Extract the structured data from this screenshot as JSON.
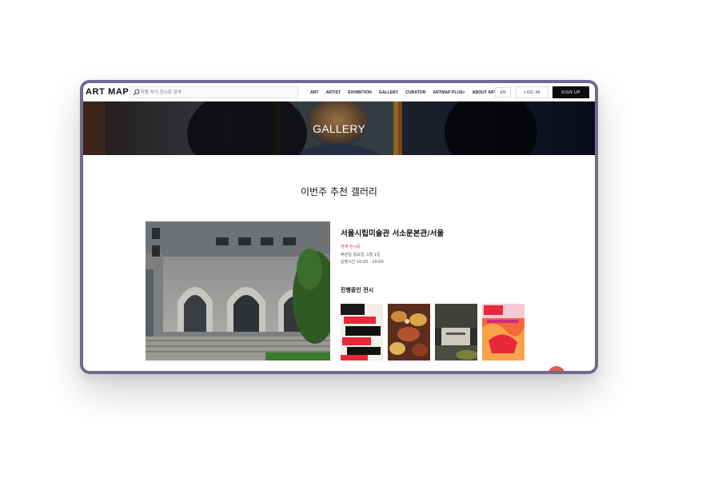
{
  "nav": {
    "logo": "ART MAP",
    "search_placeholder": "작품,작가,전시회 검색",
    "menu": [
      "ART",
      "ARTIST",
      "EXHIBITION",
      "GALLERY",
      "CURATOR",
      "ARTMAP PLUS+",
      "ABOUT ARTMAP"
    ],
    "lang": "EN",
    "login": "LOG IN",
    "signup": "SIGN UP"
  },
  "hero": {
    "title": "GALLERY"
  },
  "section": {
    "title": "이번주 추천 갤러리"
  },
  "gallery": {
    "name": "서울시립미술관 서소문본관/서울",
    "status": "현재 전시중",
    "closed": "휴관일 월요일, 1월 1일",
    "hours": "운영시간 10:00 - 20:00",
    "ongoing_title": "진행중인 전시"
  },
  "colors": {
    "accent": "#e0334a",
    "device_frame": "#6f6a8e",
    "signup_bg": "#0d0d0d"
  }
}
